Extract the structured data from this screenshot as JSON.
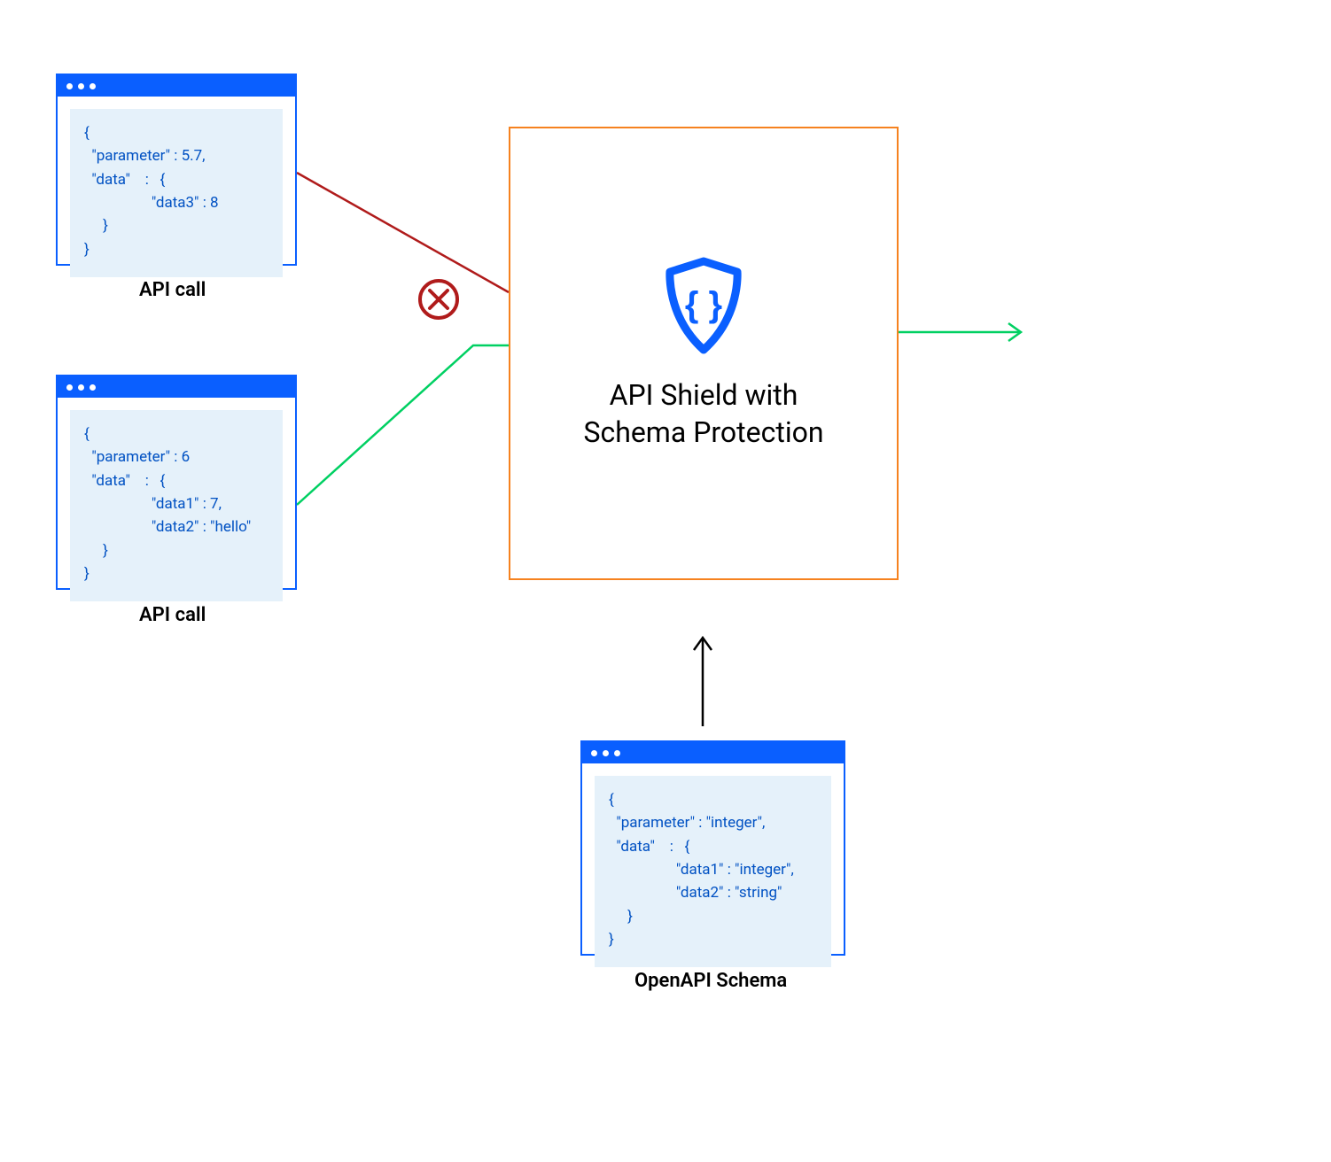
{
  "api_call_1": {
    "label": "API call",
    "code": "{\n  \"parameter\" : 5.7,\n  \"data\"    :   {\n                  \"data3\" : 8\n     }\n}"
  },
  "api_call_2": {
    "label": "API call",
    "code": "{\n  \"parameter\" : 6\n  \"data\"    :   {\n                  \"data1\" : 7,\n                  \"data2\" : \"hello\"\n     }\n}"
  },
  "schema": {
    "label": "OpenAPI Schema",
    "code": "{\n  \"parameter\" : \"integer\",\n  \"data\"    :   {\n                  \"data1\" : \"integer\",\n                  \"data2\" : \"string\"\n     }\n}"
  },
  "shield": {
    "title_line1": "API Shield with",
    "title_line2": "Schema Protection"
  },
  "colors": {
    "blue": "#0a5fff",
    "orange": "#f6821f",
    "red": "#b01b1b",
    "green": "#00d062"
  }
}
